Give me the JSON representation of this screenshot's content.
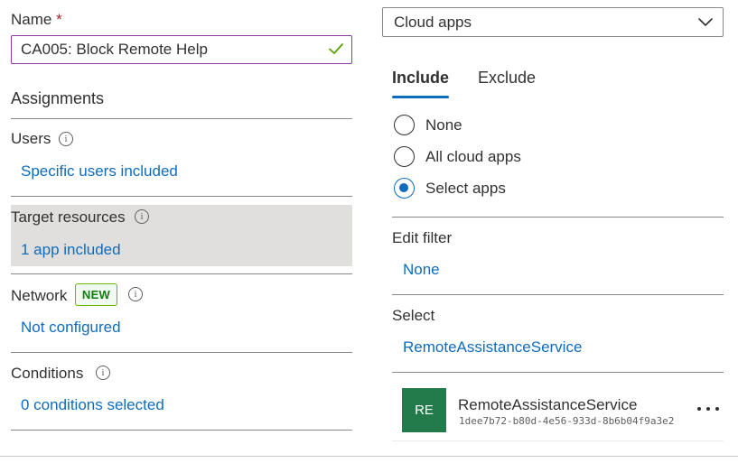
{
  "name_field": {
    "label": "Name",
    "required_mark": "*",
    "value": "CA005: Block Remote Help"
  },
  "assignments": {
    "heading": "Assignments",
    "users": {
      "label": "Users",
      "value": "Specific users included"
    },
    "target_resources": {
      "label": "Target resources",
      "value": "1 app included"
    },
    "network": {
      "label": "Network",
      "badge": "NEW",
      "value": "Not configured"
    },
    "conditions": {
      "label": "Conditions",
      "value": "0 conditions selected"
    }
  },
  "resource_type": {
    "selected": "Cloud apps"
  },
  "tabs": [
    {
      "label": "Include",
      "active": true
    },
    {
      "label": "Exclude",
      "active": false
    }
  ],
  "include_options": [
    {
      "label": "None",
      "checked": false
    },
    {
      "label": "All cloud apps",
      "checked": false
    },
    {
      "label": "Select apps",
      "checked": true
    }
  ],
  "edit_filter": {
    "label": "Edit filter",
    "value": "None"
  },
  "select": {
    "label": "Select",
    "value": "RemoteAssistanceService"
  },
  "selected_app": {
    "initials": "RE",
    "name": "RemoteAssistanceService",
    "id": "1dee7b72-b80d-4e56-933d-8b6b04f9a3e2"
  },
  "icons": {
    "info": "info-icon",
    "check": "checkmark-icon",
    "chevron": "chevron-down-icon",
    "more": "more-horizontal-icon"
  },
  "colors": {
    "link": "#0f6cbd",
    "selected_row": "#e1dfdd",
    "new_badge": "#107c10",
    "avatar": "#237b4b",
    "input_focus_border": "#8a3a9e"
  }
}
